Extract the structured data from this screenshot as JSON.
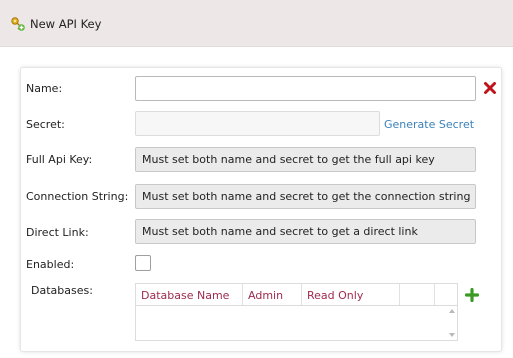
{
  "header": {
    "title": "New API Key",
    "icon": "key-add-icon"
  },
  "form": {
    "name_label": "Name:",
    "name_value": "",
    "secret_label": "Secret:",
    "secret_value": "",
    "generate_secret": "Generate Secret",
    "full_api_key_label": "Full Api Key:",
    "full_api_key_value": "Must set both name and secret to get the full api key",
    "connection_string_label": "Connection String:",
    "connection_string_value": "Must set both name and secret to get the connection string",
    "direct_link_label": "Direct Link:",
    "direct_link_value": "Must set both name and secret to get a direct link",
    "enabled_label": "Enabled:",
    "enabled_checked": false,
    "databases_label": "Databases:"
  },
  "databases_table": {
    "columns": [
      "Database Name",
      "Admin",
      "Read Only",
      "",
      ""
    ],
    "rows": []
  },
  "colors": {
    "header_bg": "#ede7e7",
    "column_header": "#9e2a4d",
    "link": "#3b82b8",
    "remove": "#c0141c",
    "add": "#3a9a24"
  }
}
